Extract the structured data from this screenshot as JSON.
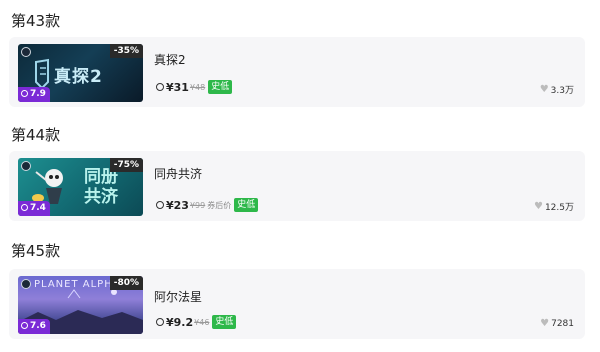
{
  "sections": [
    {
      "title": "第43款",
      "game": {
        "name": "真探2",
        "discount": "-35%",
        "score": "7.9",
        "price": "¥31",
        "original_price": "¥48",
        "note": "",
        "badge": "史低",
        "likes": "3.3万",
        "art_text": "真探2"
      }
    },
    {
      "title": "第44款",
      "game": {
        "name": "同舟共济",
        "discount": "-75%",
        "score": "7.4",
        "price": "¥23",
        "original_price": "¥99",
        "note": "券后价",
        "badge": "史低",
        "likes": "12.5万",
        "art_text_1": "同册",
        "art_text_2": "共济"
      }
    },
    {
      "title": "第45款",
      "game": {
        "name": "阿尔法星",
        "discount": "-80%",
        "score": "7.6",
        "price": "¥9.2",
        "original_price": "¥46",
        "note": "",
        "badge": "史低",
        "likes": "7281",
        "art_text": "PLANET ALPH"
      }
    }
  ],
  "colors": {
    "badge_green": "#2eb84a",
    "score_purple": "#7b2ad6",
    "card_bg": "#f6f6f8"
  },
  "icons": [
    "steam-icon",
    "currency-icon",
    "heart-icon",
    "score-icon"
  ]
}
